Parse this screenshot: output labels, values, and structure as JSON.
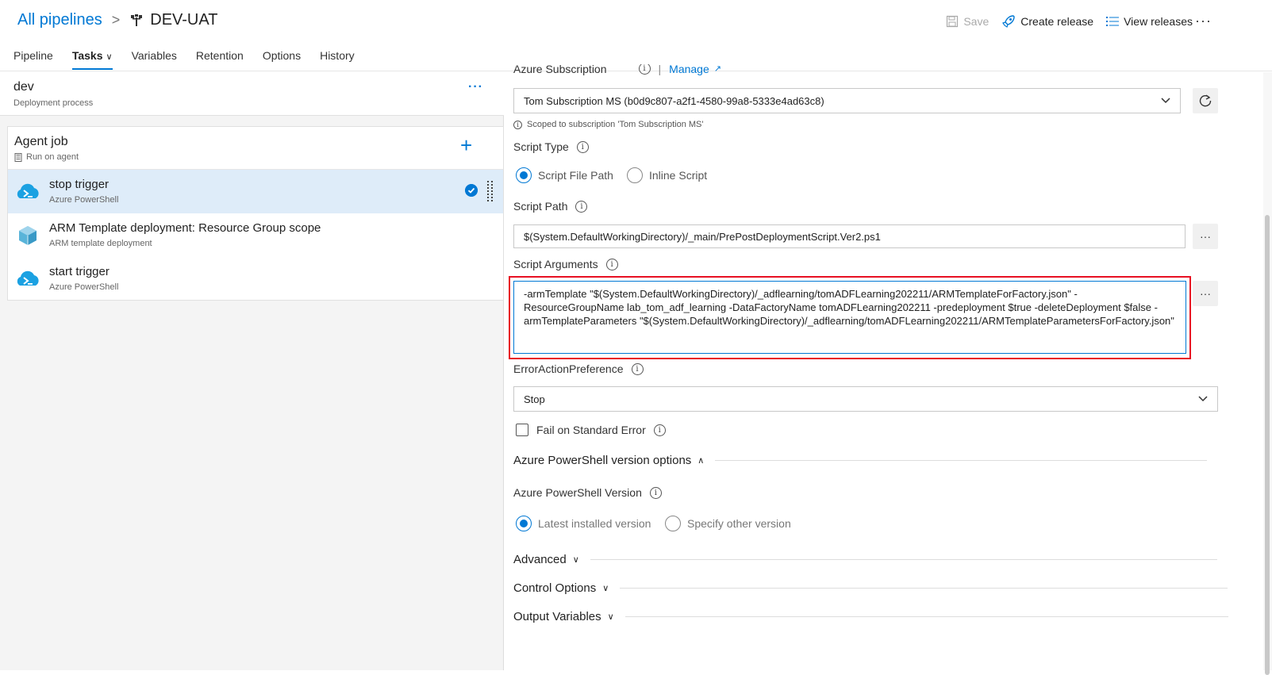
{
  "breadcrumb": {
    "root": "All pipelines",
    "pipeline": "DEV-UAT"
  },
  "actions": {
    "save": "Save",
    "create_release": "Create release",
    "view_releases": "View releases",
    "more": "···"
  },
  "tabs": [
    {
      "label": "Pipeline"
    },
    {
      "label": "Tasks"
    },
    {
      "label": "Variables"
    },
    {
      "label": "Retention"
    },
    {
      "label": "Options"
    },
    {
      "label": "History"
    }
  ],
  "stage": {
    "name": "dev",
    "subtitle": "Deployment process",
    "more": "···"
  },
  "job": {
    "title": "Agent job",
    "subtitle": "Run on agent",
    "add": "+"
  },
  "tasks": [
    {
      "name": "stop trigger",
      "subtitle": "Azure PowerShell"
    },
    {
      "name": "ARM Template deployment: Resource Group scope",
      "subtitle": "ARM template deployment"
    },
    {
      "name": "start trigger",
      "subtitle": "Azure PowerShell"
    }
  ],
  "form": {
    "azure_subscription_label": "Azure Subscription",
    "manage_link": "Manage",
    "subscription_value": "Tom Subscription MS (b0d9c807-a2f1-4580-99a8-5333e4ad63c8)",
    "scoped_note": "Scoped to subscription 'Tom Subscription MS'",
    "script_type_label": "Script Type",
    "script_type_options": [
      "Script File Path",
      "Inline Script"
    ],
    "script_path_label": "Script Path",
    "script_path_value": "$(System.DefaultWorkingDirectory)/_main/PrePostDeploymentScript.Ver2.ps1",
    "script_args_label": "Script Arguments",
    "script_args_value": "-armTemplate \"$(System.DefaultWorkingDirectory)/_adflearning/tomADFLearning202211/ARMTemplateForFactory.json\" -ResourceGroupName lab_tom_adf_learning -DataFactoryName tomADFLearning202211 -predeployment $true -deleteDeployment $false -armTemplateParameters \"$(System.DefaultWorkingDirectory)/_adflearning/tomADFLearning202211/ARMTemplateParametersForFactory.json\"",
    "error_pref_label": "ErrorActionPreference",
    "error_pref_value": "Stop",
    "fail_stderr_label": "Fail on Standard Error",
    "ps_version_section": "Azure PowerShell version options",
    "ps_version_label": "Azure PowerShell Version",
    "ps_version_options": [
      "Latest installed version",
      "Specify other version"
    ],
    "advanced_section": "Advanced",
    "control_options_section": "Control Options",
    "output_variables_section": "Output Variables",
    "ellipsis": "···"
  }
}
